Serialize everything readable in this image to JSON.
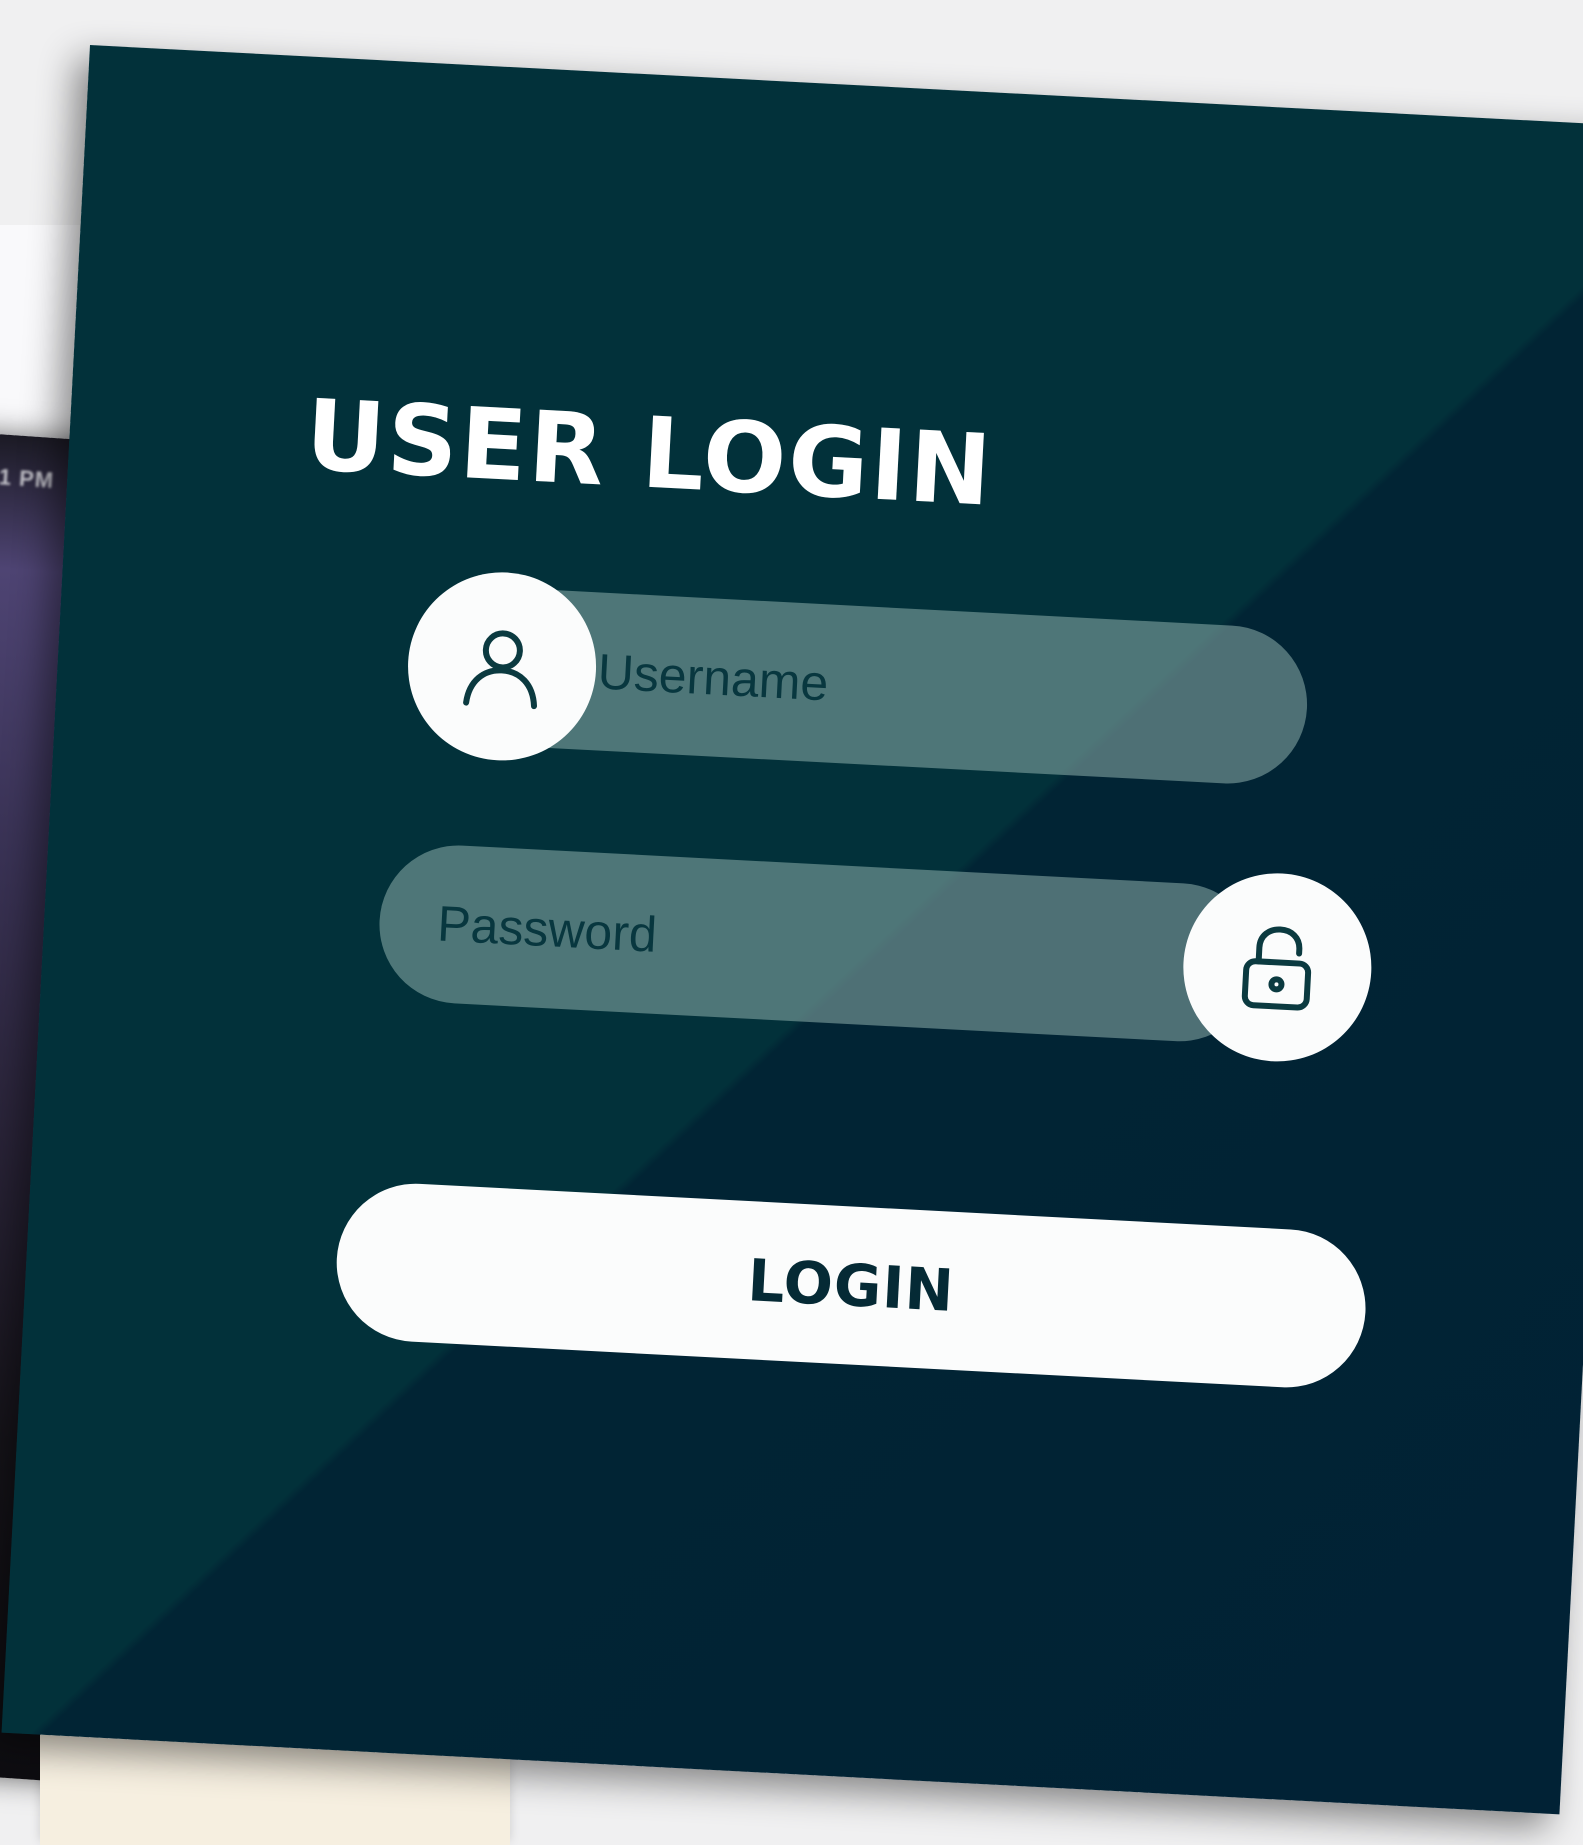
{
  "background": {
    "tablet_status_text": "1 PM"
  },
  "login_card": {
    "title": "USER LOGIN",
    "username": {
      "placeholder": "Username",
      "icon": "user-icon"
    },
    "password": {
      "placeholder": "Password",
      "icon": "unlock-icon"
    },
    "login_button_label": "LOGIN"
  },
  "colors": {
    "card_background": "#02313a",
    "card_background_dark": "#012235",
    "field_fill": "#8eafac",
    "field_text": "#05343c",
    "button_fill": "#fbfcfc",
    "button_text": "#052a35",
    "title_text": "#ffffff"
  }
}
